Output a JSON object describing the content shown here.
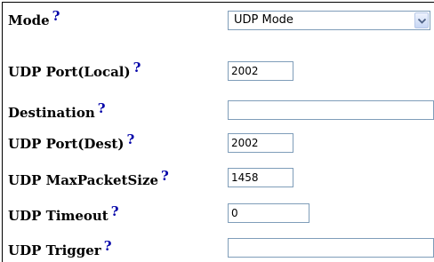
{
  "help_glyph": "?",
  "rows": [
    {
      "label": "Mode",
      "value": "UDP Mode"
    },
    {
      "label": "UDP Port(Local)",
      "value": "2002"
    },
    {
      "label": "Destination",
      "value": ""
    },
    {
      "label": "UDP Port(Dest)",
      "value": "2002"
    },
    {
      "label": "UDP MaxPacketSize",
      "value": "1458"
    },
    {
      "label": "UDP Timeout",
      "value": "0"
    },
    {
      "label": "UDP Trigger",
      "value": ""
    }
  ],
  "colors": {
    "help": "#0000a8",
    "field_border": "#7f9db9"
  }
}
